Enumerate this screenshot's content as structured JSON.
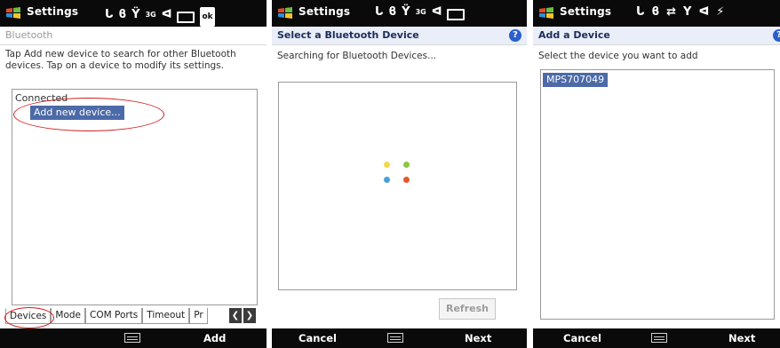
{
  "screens": [
    {
      "app_title": "Settings",
      "status": {
        "network": "3G",
        "battery_label": "ok"
      },
      "page_header": "Bluetooth",
      "instructions": "Tap Add new device to search for other Bluetooth devices. Tap on a device to modify its settings.",
      "list_group": "Connected",
      "list_item": "Add new device...",
      "tabs": [
        "Devices",
        "Mode",
        "COM Ports",
        "Timeout",
        "Pr"
      ],
      "softkey_right": "Add"
    },
    {
      "app_title": "Settings",
      "status": {
        "network": "3G"
      },
      "page_header": "Select a Bluetooth Device",
      "search_status": "Searching for Bluetooth Devices...",
      "refresh_button": "Refresh",
      "softkey_left": "Cancel",
      "softkey_right": "Next",
      "dot_colors": [
        "#f4d64a",
        "#8dc63f",
        "#47a0d9",
        "#e4582b"
      ]
    },
    {
      "app_title": "Settings",
      "page_header": "Add a Device",
      "instructions": "Select the device you want to add",
      "devices": [
        "MPS707049"
      ],
      "softkey_left": "Cancel",
      "softkey_right": "Next"
    }
  ],
  "colors": {
    "selection": "#4c6aa8",
    "annotation": "#d11d1d",
    "help_icon": "#2a5ec9"
  },
  "icons": [
    "windows-start-icon",
    "call-icon",
    "bluetooth-icon",
    "signal-icon",
    "speaker-icon",
    "battery-icon",
    "help-icon",
    "keyboard-icon"
  ]
}
